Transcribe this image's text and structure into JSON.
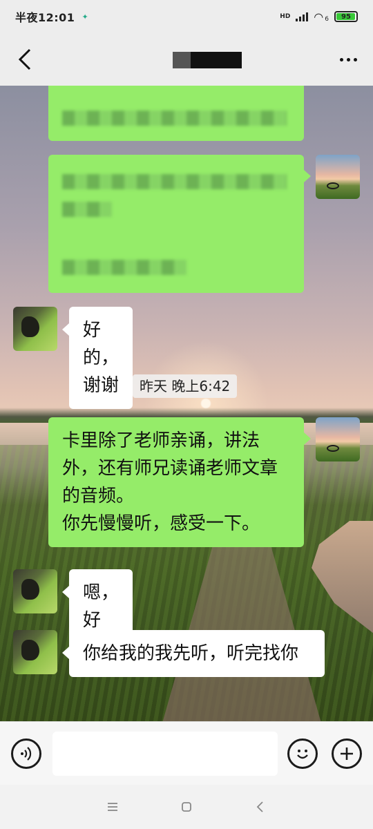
{
  "status_bar": {
    "time": "半夜12:01",
    "network": "HD",
    "wifi_badge": "6",
    "battery": "95",
    "battery_level": 0.95
  },
  "title_bar": {
    "back_icon": "chevron-left-icon",
    "more_icon": "more-dots-icon"
  },
  "messages": [
    {
      "sender": "me",
      "type": "blurred"
    },
    {
      "sender": "me",
      "type": "blurred"
    },
    {
      "sender": "other",
      "text": "好的，谢谢"
    },
    {
      "type": "timestamp",
      "text": "昨天 晚上6:42"
    },
    {
      "sender": "me",
      "text": "卡里除了老师亲诵，讲法外，还有师兄读诵老师文章的音频。\n你先慢慢听，感受一下。"
    },
    {
      "sender": "other",
      "text": "嗯，好"
    },
    {
      "sender": "other",
      "text": "你给我的我先听，听完找你"
    }
  ],
  "input_bar": {
    "voice_icon": "voice-icon",
    "emoji_icon": "emoji-icon",
    "plus_icon": "plus-icon",
    "placeholder": ""
  },
  "nav_bar": {
    "menu_icon": "menu-icon",
    "home_icon": "home-square-icon",
    "back_icon": "nav-back-icon"
  }
}
